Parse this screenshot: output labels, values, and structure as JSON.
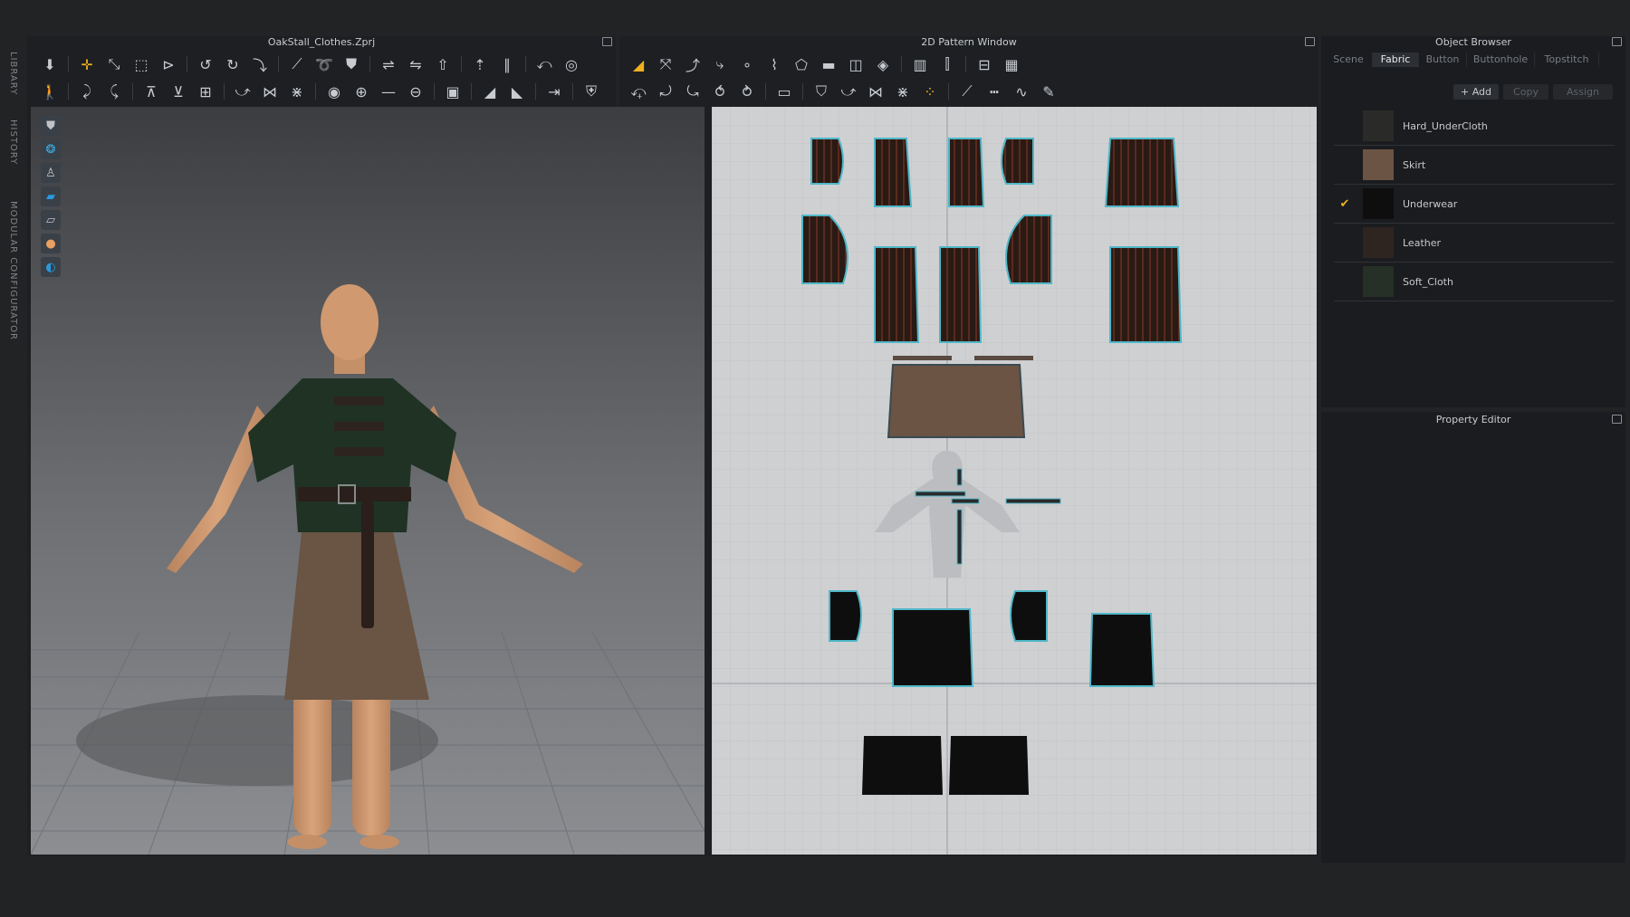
{
  "viewport3d": {
    "title": "OakStall_Clothes.Zprj"
  },
  "pattern2d": {
    "title": "2D Pattern Window"
  },
  "left_tabs": {
    "library": "LIBRARY",
    "history": "HISTORY",
    "modular": "MODULAR CONFIGURATOR"
  },
  "object_browser": {
    "title": "Object Browser",
    "tabs": [
      "Scene",
      "Fabric",
      "Button",
      "Buttonhole",
      "Topstitch"
    ],
    "active_tab": "Fabric",
    "actions": {
      "add": "+ Add",
      "copy": "Copy",
      "assign": "Assign"
    },
    "materials": [
      {
        "name": "Hard_UnderCloth",
        "color": "#2a2a28",
        "checked": false
      },
      {
        "name": "Skirt",
        "color": "#6b5443",
        "checked": false
      },
      {
        "name": "Underwear",
        "color": "#0e0e0e",
        "checked": true
      },
      {
        "name": "Leather",
        "color": "#2e2420",
        "checked": false
      },
      {
        "name": "Soft_Cloth",
        "color": "#263026",
        "checked": false
      }
    ],
    "check_mark": "✔"
  },
  "property_editor": {
    "title": "Property Editor"
  },
  "icons": {
    "toolbar_3d_row1": [
      "select-mesh-icon",
      "move-icon",
      "transform-icon",
      "box-select-icon",
      "tack-icon",
      "fold-icon",
      "fold-arrange-icon",
      "fold-down-icon",
      "pin-icon",
      "strap-icon",
      "shirt-icon",
      "line-icon",
      "shape-icon",
      "arrange-icon",
      "arrange-alt-icon",
      "sewing-icon",
      "cycle-icon"
    ],
    "toolbar_3d_row2": [
      "avatar-pose-icon",
      "edit-avatar-icon",
      "measure-icon",
      "garment-fit-icon",
      "tape-icon",
      "pin-point-icon",
      "brush-icon",
      "zip-icon",
      "hook-icon",
      "button-icon",
      "topstitch-icon",
      "buttonhole-icon",
      "line-draw-icon",
      "lock-icon",
      "scale-icon",
      "hide-icon",
      "show-icon",
      "align-icon",
      "flip-icon"
    ],
    "toolbar_2d_row1": [
      "edit-pattern-icon",
      "transform-pattern-icon",
      "curve-point-icon",
      "curvature-icon",
      "add-point-icon",
      "cut-icon",
      "polygon-icon",
      "rectangle-icon",
      "ellipse-icon",
      "internal-polygon-icon",
      "dart-icon",
      "pleat-icon",
      "grain-icon",
      "grid-icon"
    ],
    "toolbar_2d_row2": [
      "edit-sewing-icon",
      "segment-sew-icon",
      "free-sew-icon",
      "m-n-sew-icon",
      "check-sew-icon",
      "fold-2d-icon",
      "tack-2d-icon",
      "pin-2d-icon",
      "trace-icon",
      "sync-icon",
      "button-2d-icon",
      "annotation-icon",
      "ruler-icon",
      "dashed-line-icon",
      "wave-icon",
      "pen-icon"
    ]
  }
}
